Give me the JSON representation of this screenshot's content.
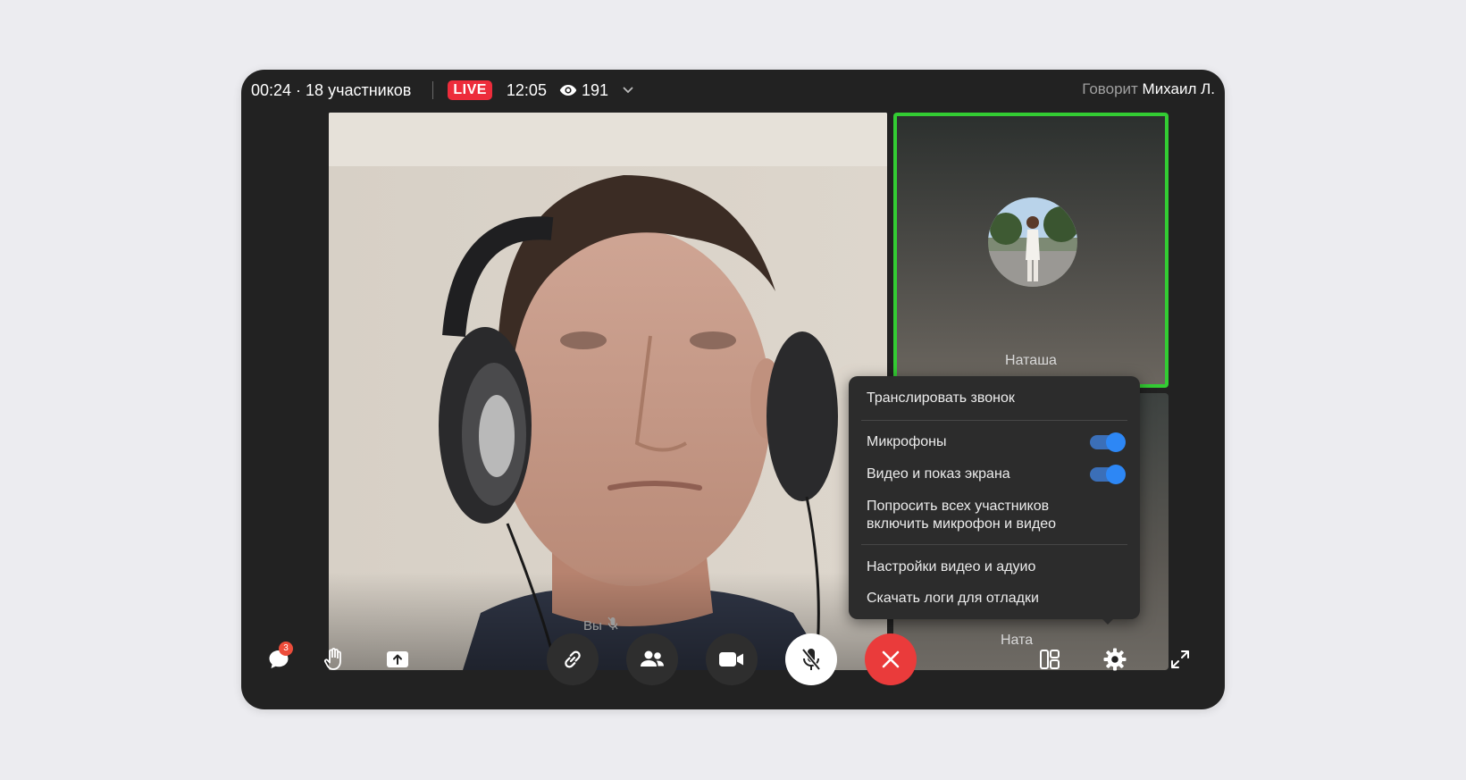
{
  "topbar": {
    "duration": "00:24",
    "participants": "· 18 участников",
    "live_label": "LIVE",
    "live_time": "12:05",
    "viewers": "191",
    "speaking_label": "Говорит",
    "speaker_name": "Михаил Л."
  },
  "tiles": {
    "speaker_tile_name": "Наташа",
    "second_tile_name": "Ната",
    "self_label": "Вы"
  },
  "menu": {
    "broadcast": "Транслировать звонок",
    "microphones": "Микрофоны",
    "microphones_on": true,
    "video_screen": "Видео и показ экрана",
    "video_screen_on": true,
    "ask_all_line1": "Попросить всех участников",
    "ask_all_line2": "включить микрофон и видео",
    "av_settings": "Настройки видео и адуио",
    "download_logs": "Скачать логи для отладки"
  },
  "controls": {
    "chat_unread": "3",
    "icons": [
      "chat-icon",
      "raise-hand-icon",
      "share-screen-icon",
      "link-icon",
      "participants-icon",
      "camera-icon",
      "mic-off-icon",
      "end-call-icon",
      "layout-icon",
      "settings-icon",
      "fullscreen-icon"
    ]
  },
  "colors": {
    "live": "#ed2c3b",
    "active_speaker_border": "#33cc33",
    "toggle_on": "#2d87f5",
    "end_call": "#ea3b3b"
  }
}
